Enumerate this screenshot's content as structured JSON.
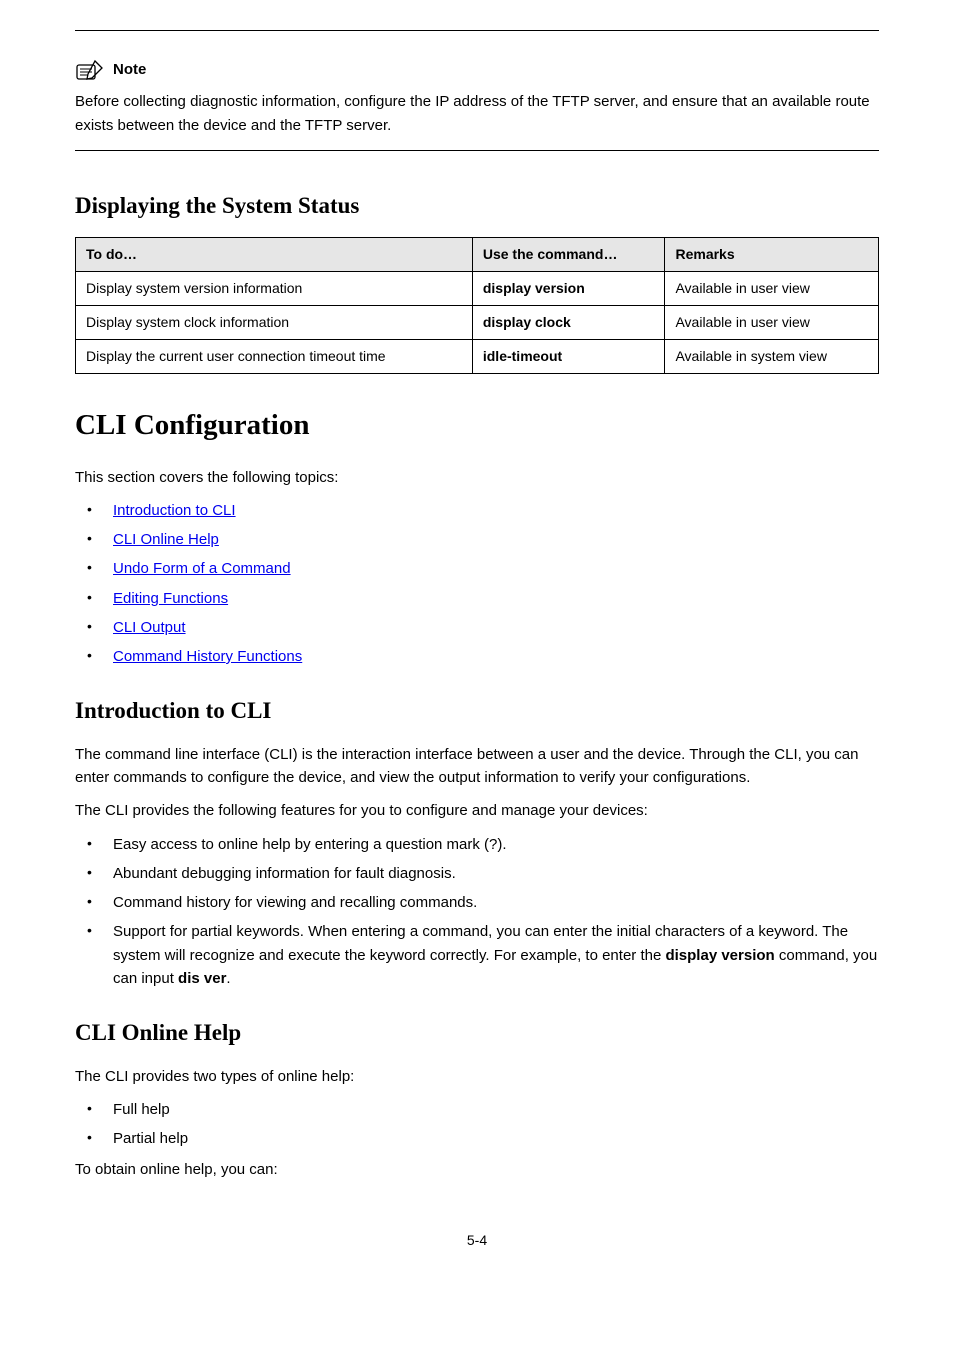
{
  "note": {
    "label": "Note",
    "body": "Before collecting diagnostic information, configure the IP address of the TFTP server, and ensure that an available route exists between the device and the TFTP server."
  },
  "sections": {
    "displaying_title": "Displaying the System Status",
    "cli_title": "CLI Configuration",
    "intro_title": "Introduction to CLI",
    "online_help_title": "CLI Online Help"
  },
  "table": {
    "headers": [
      "To do…",
      "Use the command…",
      "Remarks"
    ],
    "rows": [
      {
        "c0": "Display system version information",
        "c1": "display version",
        "c2": "Available in user view"
      },
      {
        "c0": "Display system clock information",
        "c1": "display clock",
        "c2": "Available in user view"
      },
      {
        "c0": "Display the current user connection timeout time",
        "c1": "idle-timeout",
        "c2": "Available in system view"
      }
    ]
  },
  "cli_section": {
    "intro": "This section covers the following topics:",
    "links": [
      "Introduction to CLI",
      "CLI Online Help",
      "Undo Form of a Command",
      "Editing Functions",
      "CLI Output",
      "Command History Functions"
    ]
  },
  "intro_para1": "The command line interface (CLI) is the interaction interface between a user and the device. Through the CLI, you can enter commands to configure the device, and view the output information to verify your configurations.",
  "intro_para2": "The CLI provides the following features for you to configure and manage your devices:",
  "intro_bullets": {
    "b0": "Easy access to online help by entering a question mark (?).",
    "b1": "Abundant debugging information for fault diagnosis.",
    "b2": "Command history for viewing and recalling commands.",
    "b3_part1": "Support for partial keywords. When entering a command, you can enter the initial characters of a keyword. The system will recognize and execute the keyword correctly. For example, to enter the ",
    "b3_bold1": "display version",
    "b3_part2": " command, you can input ",
    "b3_bold2": "dis ver",
    "b3_part3": "."
  },
  "online_help": {
    "para1": "The CLI provides two types of online help:",
    "bullets": [
      "Full help",
      "Partial help"
    ],
    "para2": "To obtain online help, you can:"
  },
  "footer": "5-4"
}
